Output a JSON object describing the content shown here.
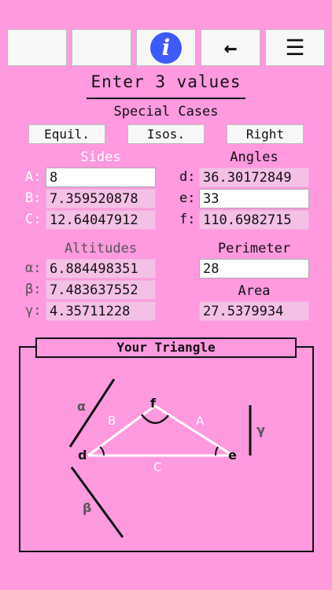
{
  "toolbar": {
    "buttons": [
      {
        "label": "",
        "icon": "blank"
      },
      {
        "label": "",
        "icon": "blank"
      },
      {
        "label": "i",
        "icon": "info-icon"
      },
      {
        "label": "←",
        "icon": "back-arrow-icon"
      },
      {
        "label": "☰",
        "icon": "menu-icon"
      }
    ]
  },
  "title": "Enter 3 values",
  "special_cases": {
    "heading": "Special Cases",
    "buttons": [
      "Equil.",
      "Isos.",
      "Right"
    ]
  },
  "sides": {
    "heading": "Sides",
    "labels": [
      "A:",
      "B:",
      "C:"
    ],
    "values": [
      "8",
      "7.359520878",
      "12.64047912"
    ]
  },
  "angles": {
    "heading": "Angles",
    "labels": [
      "d:",
      "e:",
      "f:"
    ],
    "values": [
      "36.30172849",
      "33",
      "110.6982715"
    ]
  },
  "altitudes": {
    "heading": "Altitudes",
    "labels": [
      "α:",
      "β:",
      "γ:"
    ],
    "values": [
      "6.884498351",
      "7.483637552",
      "4.35711228"
    ]
  },
  "perimeter": {
    "label": "Perimeter",
    "value": "28"
  },
  "area": {
    "label": "Area",
    "value": "27.5379934"
  },
  "triangle": {
    "title": "Your Triangle",
    "vertex_labels": {
      "d": "d",
      "e": "e",
      "f": "f"
    },
    "side_labels": {
      "A": "A",
      "B": "B",
      "C": "C"
    },
    "altitude_labels": {
      "alpha": "α",
      "beta": "β",
      "gamma": "γ"
    }
  },
  "colors": {
    "background": "#ff99e0",
    "accent": "#3d5afe",
    "input_bg": "#ffffff",
    "output_bg": "#f4c0e6"
  }
}
